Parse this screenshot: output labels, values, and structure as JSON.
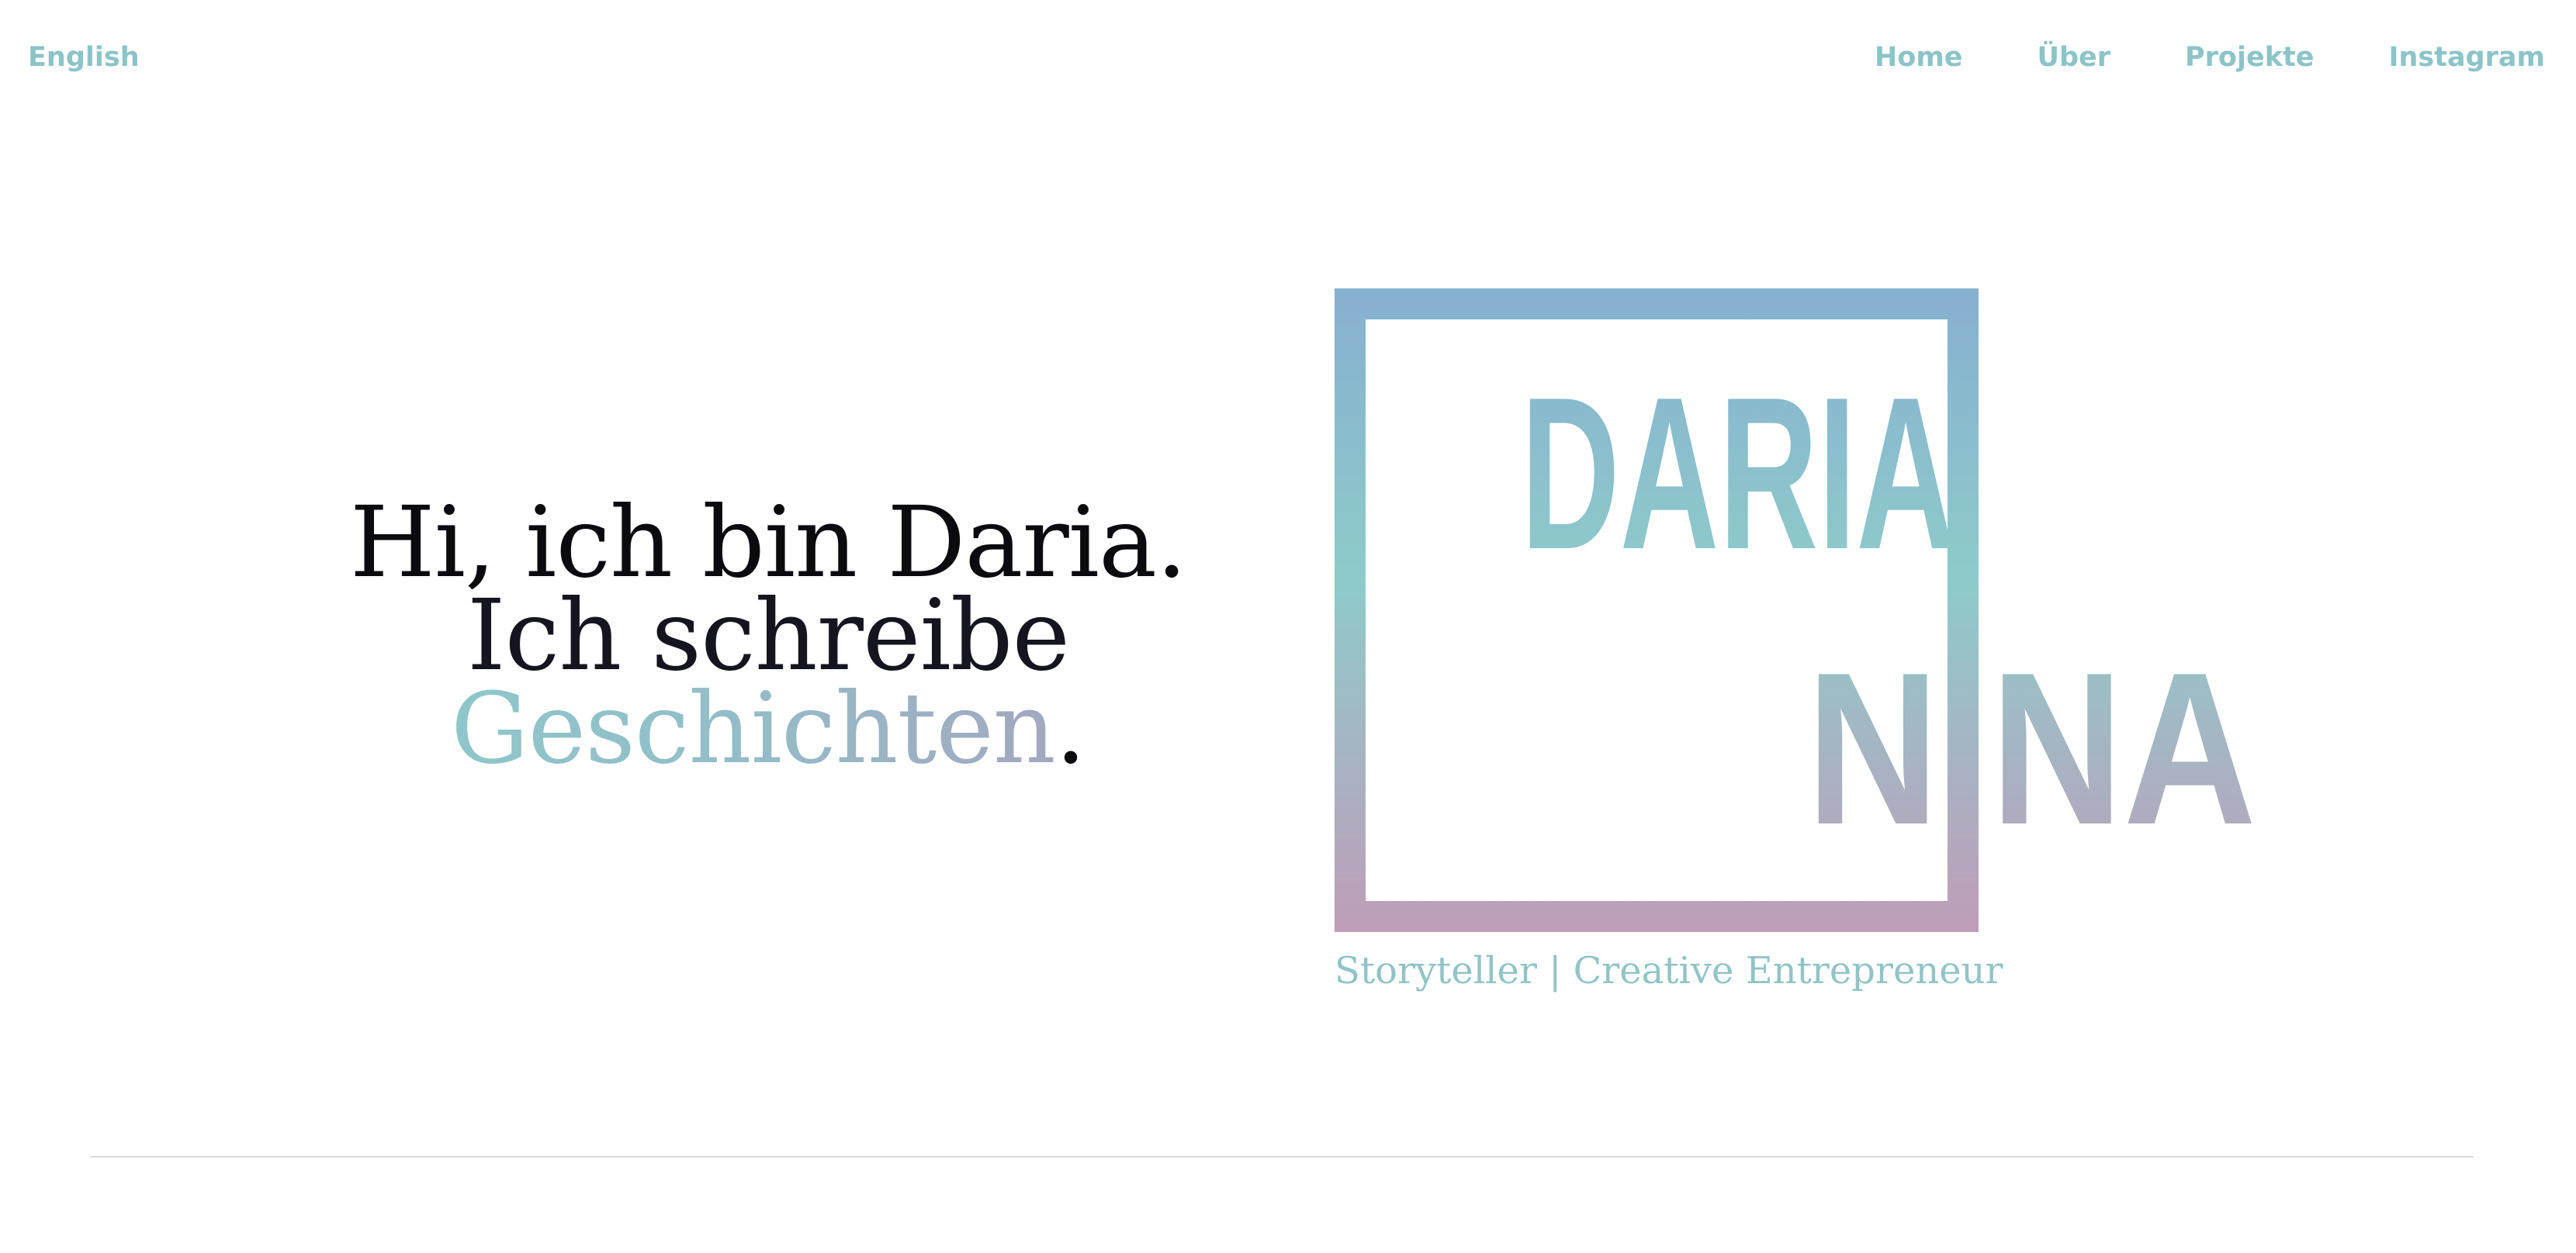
{
  "nav": {
    "language_label": "English",
    "items": [
      {
        "label": "Home"
      },
      {
        "label": "Über"
      },
      {
        "label": "Projekte"
      },
      {
        "label": "Instagram"
      }
    ]
  },
  "hero": {
    "line1": "Hi, ich bin Daria.",
    "line2": "Ich schreibe",
    "line3_word": "Geschichten",
    "line3_end": "."
  },
  "logo": {
    "word1": "DARIA",
    "word2": "NINA",
    "gradient_colors": [
      "#86b0d0",
      "#8ecbca",
      "#c09cb8"
    ],
    "tagline": "Storyteller | Creative Entrepreneur"
  },
  "colors": {
    "accent": "#8cc4c8",
    "text": "#0b0b0f",
    "divider": "#d8dcdf"
  }
}
